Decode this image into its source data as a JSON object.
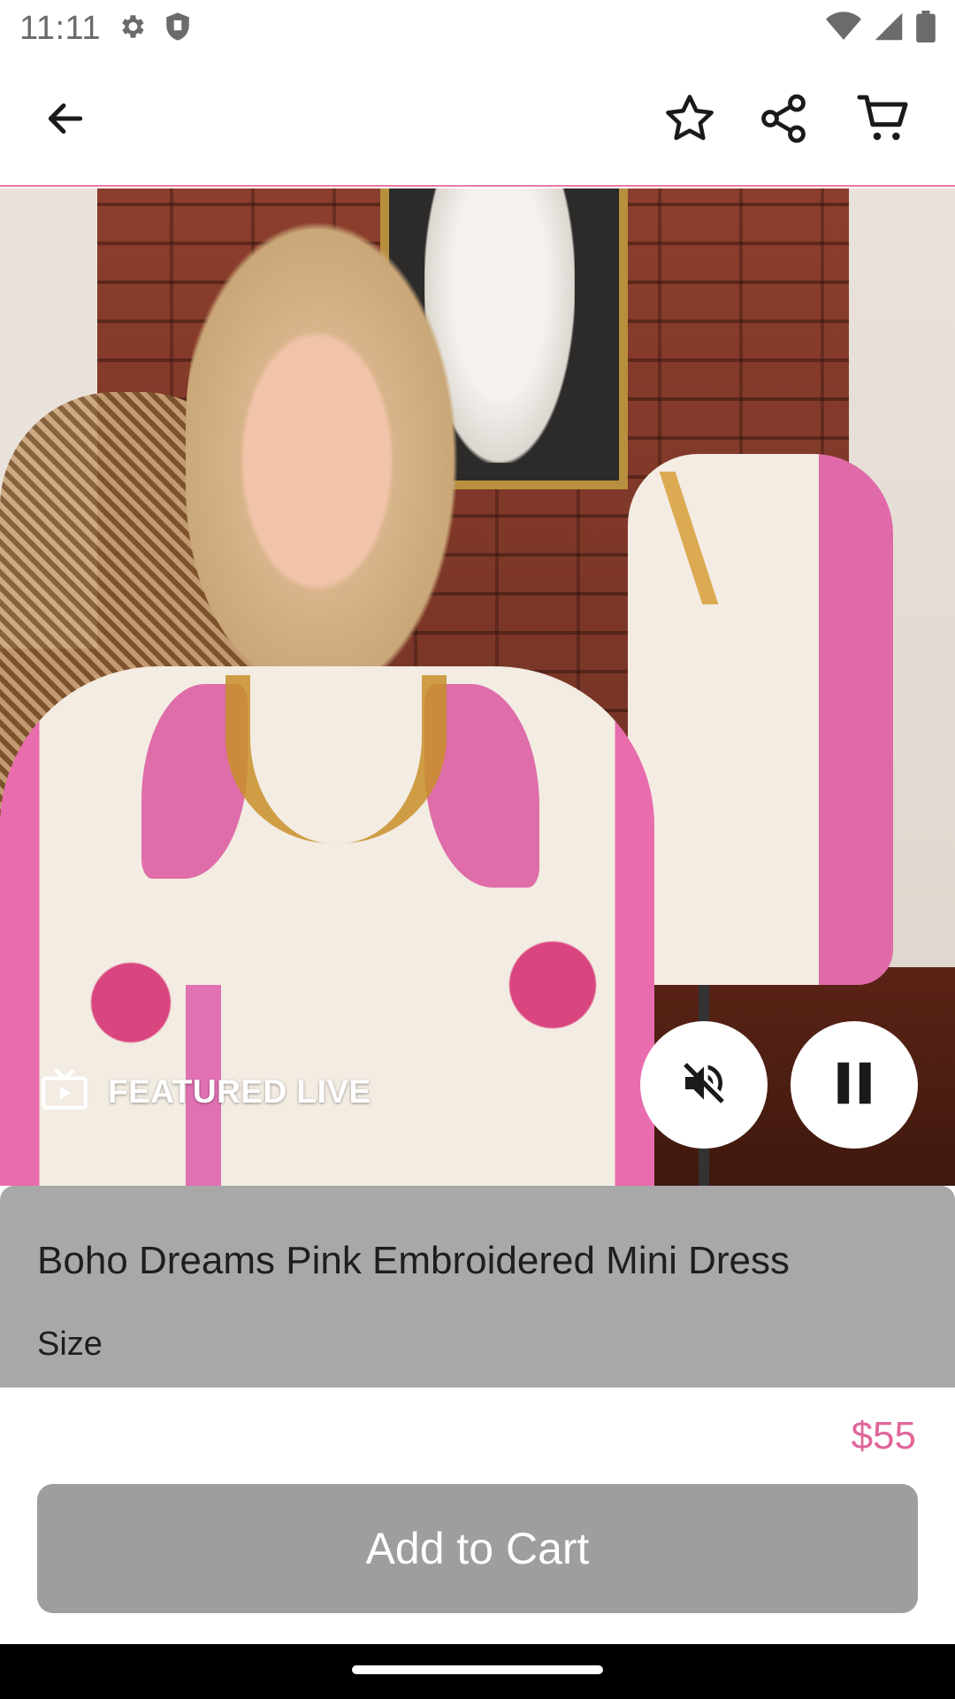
{
  "status_bar": {
    "time": "11:11",
    "icons": [
      "gear-icon",
      "shield-icon",
      "wifi-icon",
      "signal-icon",
      "battery-icon"
    ]
  },
  "app_bar": {
    "icons": [
      "back-arrow-icon",
      "star-icon",
      "share-icon",
      "cart-icon"
    ]
  },
  "video": {
    "badge_icon": "tv-icon",
    "badge_label": "FEATURED LIVE",
    "controls": [
      "mute-icon",
      "pause-icon"
    ]
  },
  "product": {
    "title": "Boho Dreams Pink Embroidered Mini Dress",
    "size_label": "Size",
    "price": "$55",
    "add_to_cart_label": "Add to Cart"
  },
  "colors": {
    "accent_pink": "#e0669a",
    "button_disabled": "#9e9e9e"
  }
}
